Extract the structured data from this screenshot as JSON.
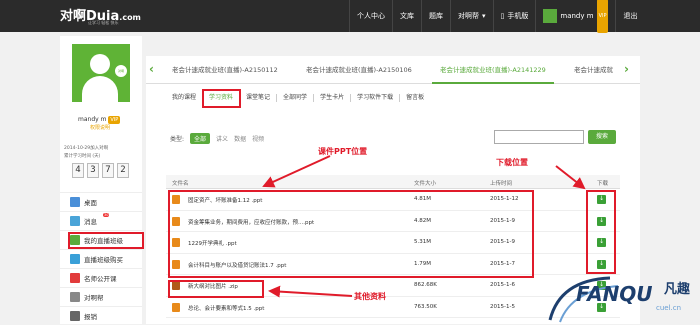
{
  "header": {
    "logo": "对啊Duia",
    "logo_suffix": ".com",
    "slogan": "让学习 轻松 快乐",
    "nav": [
      "个人中心",
      "文库",
      "题库",
      "对啊帮",
      "手机版"
    ],
    "username": "mandy m",
    "vip": "VIP",
    "logout": "退出"
  },
  "sidebar": {
    "avatar_badge": "对啊",
    "username": "mandy m",
    "vip": "VIP",
    "privilege": "权限说明",
    "joined": "2014-10-29加入对啊",
    "days_label": "累计学习时间 (天)",
    "digits": [
      "4",
      "3",
      "7",
      "2"
    ],
    "menu": [
      {
        "label": "桌面",
        "badge": ""
      },
      {
        "label": "消息",
        "badge": "30"
      },
      {
        "label": "我的直播班级",
        "badge": ""
      },
      {
        "label": "直播班级购买",
        "badge": ""
      },
      {
        "label": "名师公开课",
        "badge": ""
      },
      {
        "label": "对啊帮",
        "badge": ""
      },
      {
        "label": "报销",
        "badge": ""
      }
    ]
  },
  "tabs": [
    "老会计速成就业班(直播)-A2150112",
    "老会计速成就业班(直播)-A2150106",
    "老会计速成就业班(直播)-A2141229",
    "老会计速成就"
  ],
  "subnav": [
    "我的课程",
    "学习资料",
    "课堂笔记",
    "全部同学",
    "学生卡片",
    "学习软件下载",
    "留言板"
  ],
  "filter": {
    "label": "类型:",
    "options": [
      "全部",
      "讲义",
      "数据",
      "视频"
    ],
    "search_btn": "搜索"
  },
  "table": {
    "headers": [
      "文件名",
      "文件大小",
      "上传时间",
      "下载"
    ],
    "rows": [
      {
        "name": "固定资产、坏账准备1.12 .ppt",
        "size": "4.81M",
        "date": "2015-1-12",
        "type": "ppt"
      },
      {
        "name": "资金筹集业务，期间费用，应收应付账款，预....ppt",
        "size": "4.82M",
        "date": "2015-1-9",
        "type": "ppt"
      },
      {
        "name": "1229开学典礼 .ppt",
        "size": "5.31M",
        "date": "2015-1-9",
        "type": "ppt"
      },
      {
        "name": "会计科目与账户以及借贷记账法1.7 .ppt",
        "size": "1.79M",
        "date": "2015-1-7",
        "type": "ppt"
      },
      {
        "name": "新大纲对比图片 .zip",
        "size": "862.68K",
        "date": "2015-1-6",
        "type": "zip"
      },
      {
        "name": "总论、会计要素和等式1.5 .ppt",
        "size": "763.50K",
        "date": "2015-1-5",
        "type": "ppt"
      }
    ]
  },
  "annotations": {
    "ppt": "课件PPT位置",
    "download": "下载位置",
    "other": "其他资料"
  },
  "watermark": {
    "brand": "FANQU",
    "cn": "凡趣",
    "url": "cuel.cn"
  },
  "colors": {
    "accent": "#5aaa3c",
    "annotation": "#e01b2a",
    "topbar": "#2b2b2b"
  }
}
